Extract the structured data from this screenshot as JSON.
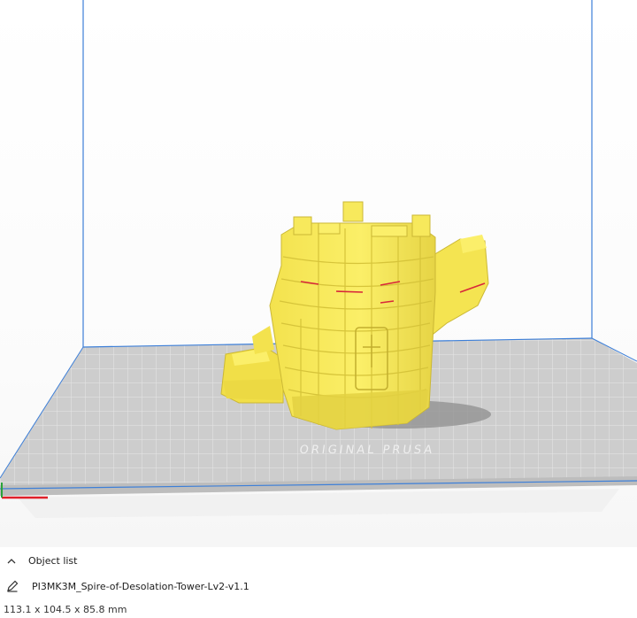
{
  "object_panel": {
    "header_label": "Object list",
    "file_name": "PI3MK3M_Spire-of-Desolation-Tower-Lv2-v1.1",
    "dimensions": "113.1 x 104.5 x 85.8 mm",
    "icons": {
      "collapse": "chevron-up-icon",
      "edit": "pencil-icon"
    }
  },
  "build_plate": {
    "watermark": "ORIGINAL PRUSA"
  },
  "colors": {
    "model": "#f5e65a",
    "model_shadow": "#d9c93c",
    "overhang": "#d8263a",
    "plate": "#c8c8c8",
    "plate_grid": "#e2e2e2",
    "volume_edge": "#3d7fd8",
    "x_axis": "#e0202a",
    "y_axis": "#2aa33a"
  }
}
